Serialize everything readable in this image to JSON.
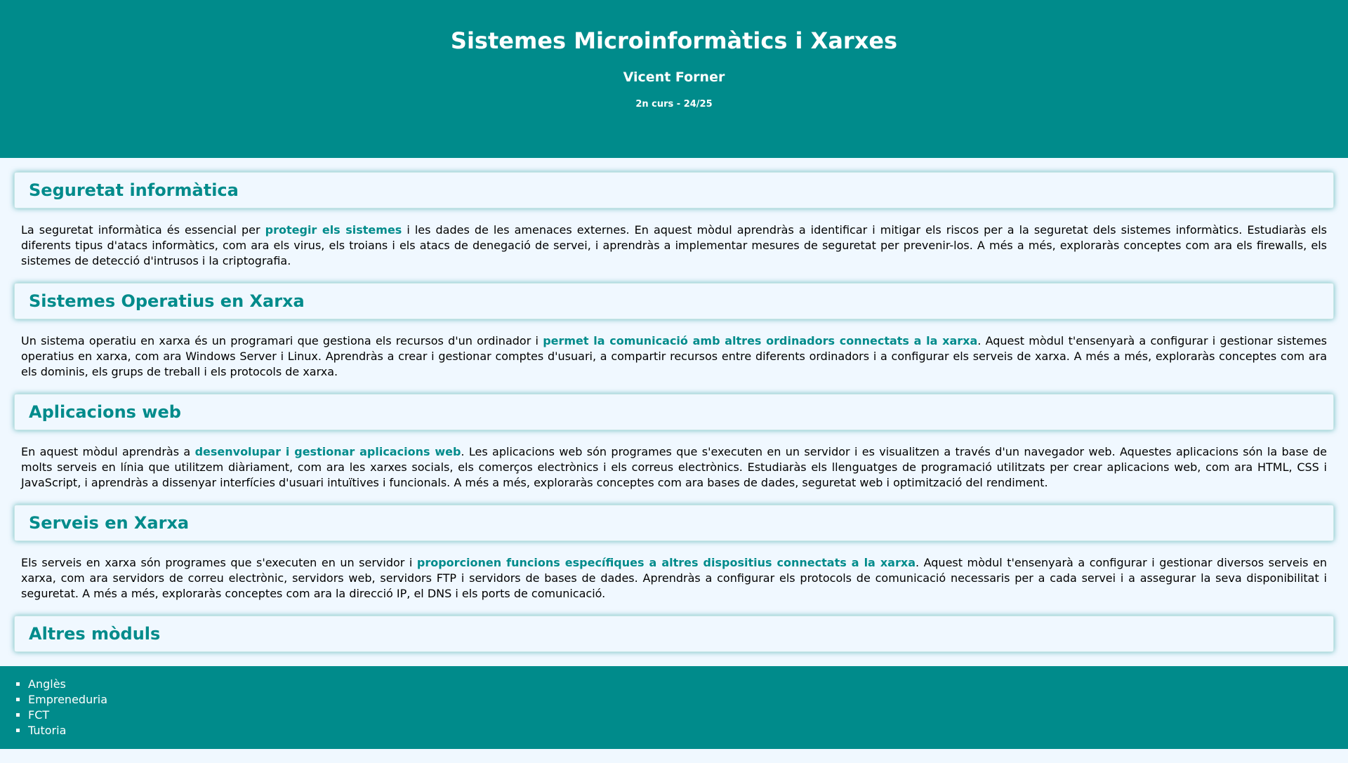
{
  "header": {
    "title": "Sistemes Microinformàtics i Xarxes",
    "author": "Vicent Forner",
    "course": "2n curs - 24/25"
  },
  "sections": [
    {
      "title": "Seguretat informàtica",
      "pre": "La seguretat informàtica és essencial per ",
      "highlight": "protegir els sistemes",
      "post": " i les dades de les amenaces externes. En aquest mòdul aprendràs a identificar i mitigar els riscos per a la seguretat dels sistemes informàtics. Estudiaràs els diferents tipus d'atacs informàtics, com ara els virus, els troians i els atacs de denegació de servei, i aprendràs a implementar mesures de seguretat per prevenir-los. A més a més, exploraràs conceptes com ara els firewalls, els sistemes de detecció d'intrusos i la criptografia."
    },
    {
      "title": "Sistemes Operatius en Xarxa",
      "pre": "Un sistema operatiu en xarxa és un programari que gestiona els recursos d'un ordinador i ",
      "highlight": "permet la comunicació amb altres ordinadors connectats a la xarxa",
      "post": ". Aquest mòdul t'ensenyarà a configurar i gestionar sistemes operatius en xarxa, com ara Windows Server i Linux. Aprendràs a crear i gestionar comptes d'usuari, a compartir recursos entre diferents ordinadors i a configurar els serveis de xarxa. A més a més, exploraràs conceptes com ara els dominis, els grups de treball i els protocols de xarxa."
    },
    {
      "title": "Aplicacions web",
      "pre": "En aquest mòdul aprendràs a ",
      "highlight": "desenvolupar i gestionar aplicacions web",
      "post": ". Les aplicacions web són programes que s'executen en un servidor i es visualitzen a través d'un navegador web. Aquestes aplicacions són la base de molts serveis en línia que utilitzem diàriament, com ara les xarxes socials, els comerços electrònics i els correus electrònics. Estudiaràs els llenguatges de programació utilitzats per crear aplicacions web, com ara HTML, CSS i JavaScript, i aprendràs a dissenyar interfícies d'usuari intuïtives i funcionals. A més a més, exploraràs conceptes com ara bases de dades, seguretat web i optimització del rendiment."
    },
    {
      "title": "Serveis en Xarxa",
      "pre": "Els serveis en xarxa són programes que s'executen en un servidor i ",
      "highlight": "proporcionen funcions específiques a altres dispositius connectats a la xarxa",
      "post": ". Aquest mòdul t'ensenyarà a configurar i gestionar diversos serveis en xarxa, com ara servidors de correu electrònic, servidors web, servidors FTP i servidors de bases de dades. Aprendràs a configurar els protocols de comunicació necessaris per a cada servei i a assegurar la seva disponibilitat i seguretat. A més a més, exploraràs conceptes com ara la direcció IP, el DNS i els ports de comunicació."
    }
  ],
  "other": {
    "title": "Altres mòduls",
    "items": [
      "Anglès",
      "Empreneduria",
      "FCT",
      "Tutoria"
    ]
  }
}
